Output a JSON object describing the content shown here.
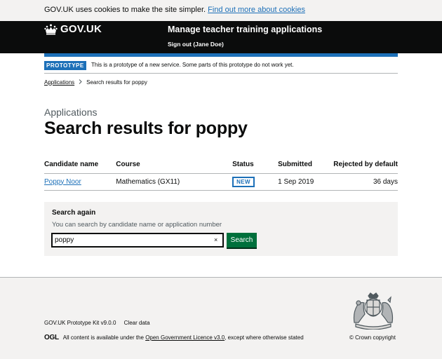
{
  "cookie_banner": {
    "text": "GOV.UK uses cookies to make the site simpler.",
    "link": "Find out more about cookies"
  },
  "header": {
    "logo_text": "GOV.UK",
    "service_name": "Manage teacher training applications",
    "sign_out": "Sign out (Jane Doe)"
  },
  "phase_banner": {
    "tag": "PROTOTYPE",
    "text": "This is a prototype of a new service. Some parts of this prototype do not work yet."
  },
  "breadcrumbs": {
    "link": "Applications",
    "current": "Search results for poppy"
  },
  "page": {
    "caption": "Applications",
    "title": "Search results for poppy"
  },
  "table": {
    "headers": [
      "Candidate name",
      "Course",
      "Status",
      "Submitted",
      "Rejected by default"
    ],
    "rows": [
      {
        "candidate": "Poppy Noor",
        "course": "Mathematics (GX11)",
        "status": "NEW",
        "submitted": "1 Sep 2019",
        "rejected_by_default": "36 days"
      }
    ]
  },
  "search": {
    "label": "Search again",
    "hint": "You can search by candidate name or application number",
    "value": "poppy",
    "clear": "×",
    "button": "Search"
  },
  "footer": {
    "kit_version": "GOV.UK Prototype Kit v9.0.0",
    "clear_data": "Clear data",
    "ogl_logo": "OGL",
    "licence_prefix": "All content is available under the",
    "licence_link": "Open Government Licence v3.0",
    "licence_suffix": ", except where otherwise stated",
    "copyright": "© Crown copyright"
  },
  "colors": {
    "link_blue": "#1d70b8",
    "header_black": "#0b0c0c",
    "button_green": "#00703c",
    "panel_grey": "#f3f2f1"
  }
}
